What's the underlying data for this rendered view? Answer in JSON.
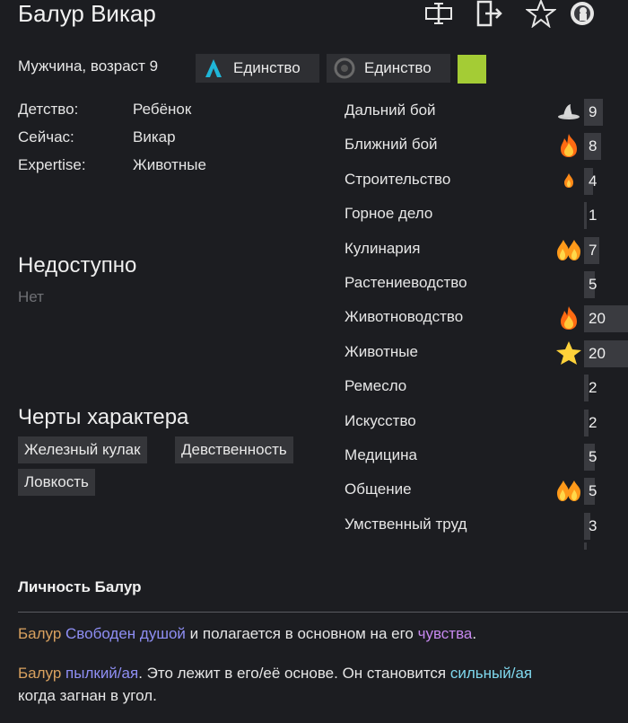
{
  "header": {
    "name": "Балур Викар",
    "info": "Мужчина, возраст 9",
    "ideologies": [
      {
        "label": "Единство",
        "icon": "ideoligion-triangle-icon",
        "color": "#1fb6d8"
      },
      {
        "label": "Единство",
        "icon": "ideoligion-circle-icon",
        "color": "#6a6a6a"
      }
    ],
    "favorite_color": "#a4cc35",
    "icons": [
      "rename-icon",
      "banish-icon",
      "favorite-star-icon",
      "prisoner-icon"
    ]
  },
  "bio": [
    {
      "label": "Детство:",
      "value": "Ребёнок"
    },
    {
      "label": "Сейчас:",
      "value": "Викар"
    },
    {
      "label": "Expertise:",
      "value": "Животные"
    }
  ],
  "incapable": {
    "title": "Недоступно",
    "value": "Нет"
  },
  "traits": {
    "title": "Черты характера",
    "items": [
      "Железный кулак",
      "Девственность",
      "Ловкость"
    ]
  },
  "skills": [
    {
      "name": "Дальний бой",
      "level": "9",
      "fill": 0.42,
      "passion": "hat"
    },
    {
      "name": "Ближний бой",
      "level": "8",
      "fill": 0.38,
      "passion": "flame-major"
    },
    {
      "name": "Строительство",
      "level": "4",
      "fill": 0.2,
      "passion": "flame-minor"
    },
    {
      "name": "Горное дело",
      "level": "1",
      "fill": 0.06,
      "passion": ""
    },
    {
      "name": "Кулинария",
      "level": "7",
      "fill": 0.34,
      "passion": "flame-double"
    },
    {
      "name": "Растениеводство",
      "level": "5",
      "fill": 0.24,
      "passion": ""
    },
    {
      "name": "Животноводство",
      "level": "20",
      "fill": 1.0,
      "passion": "flame-major"
    },
    {
      "name": "Животные",
      "level": "20",
      "fill": 1.0,
      "passion": "star"
    },
    {
      "name": "Ремесло",
      "level": "2",
      "fill": 0.1,
      "passion": ""
    },
    {
      "name": "Искусство",
      "level": "2",
      "fill": 0.1,
      "passion": ""
    },
    {
      "name": "Медицина",
      "level": "5",
      "fill": 0.24,
      "passion": ""
    },
    {
      "name": "Общение",
      "level": "5",
      "fill": 0.24,
      "passion": "flame-double"
    },
    {
      "name": "Умственный труд",
      "level": "3",
      "fill": 0.15,
      "passion": ""
    }
  ],
  "personality": {
    "title": "Личность Балур",
    "line1": {
      "name": "Балур",
      "trait": "Свободен душой",
      "mid": " и полагается в основном на его ",
      "trait2": "чувства",
      "end": "."
    },
    "line2": {
      "name": "Балур",
      "trait": "пылкий/ая",
      "mid": ". Это лежит в его/её основе. Он становится ",
      "trait2": "сильный/ая",
      "end": ""
    },
    "line3": "когда загнан в угол."
  }
}
